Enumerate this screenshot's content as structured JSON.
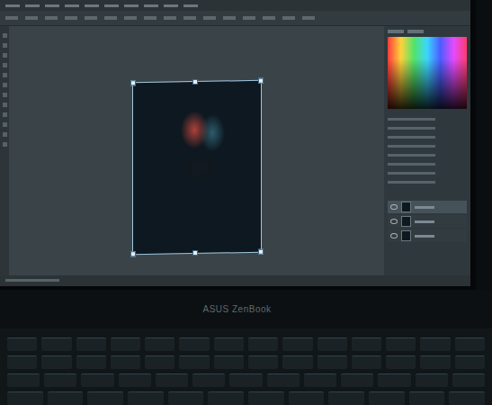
{
  "laptop": {
    "brand": "ASUS ZenBook"
  },
  "document": {
    "selected": true
  },
  "layers": [
    {
      "selected": true,
      "visible": true
    },
    {
      "selected": false,
      "visible": true
    },
    {
      "selected": false,
      "visible": true
    }
  ]
}
